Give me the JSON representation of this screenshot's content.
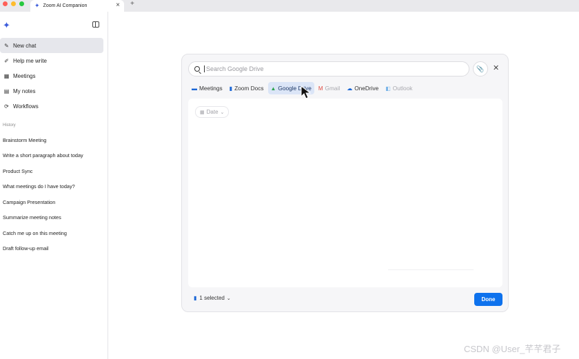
{
  "tab": {
    "title": "Zoom AI Companion",
    "close_glyph": "×",
    "new_tab_glyph": "+"
  },
  "sidebar": {
    "nav": [
      {
        "label": "New chat",
        "icon": "edit-icon",
        "glyph": "✎"
      },
      {
        "label": "Help me write",
        "icon": "magic-pen-icon",
        "glyph": "✐"
      },
      {
        "label": "Meetings",
        "icon": "calendar-icon",
        "glyph": "▦"
      },
      {
        "label": "My notes",
        "icon": "notes-icon",
        "glyph": "▤"
      },
      {
        "label": "Workflows",
        "icon": "workflow-icon",
        "glyph": "⟳"
      }
    ],
    "history_label": "History",
    "history": [
      "Brainstorm Meeting",
      "Write a short paragraph about today",
      "Product Sync",
      "What meetings do I have today?",
      "Campaign Presentation",
      "Summarize meeting notes",
      "Catch me up on this meeting",
      "Draft follow-up email"
    ]
  },
  "dialog": {
    "search": {
      "placeholder": "Search Google Drive",
      "value": ""
    },
    "sources": [
      {
        "label": "Meetings",
        "glyph": "▬",
        "icon": "meetings-icon",
        "state": "normal"
      },
      {
        "label": "Zoom Docs",
        "glyph": "▮",
        "icon": "zoom-docs-icon",
        "state": "normal"
      },
      {
        "label": "Google Drive",
        "glyph": "▲",
        "icon": "google-drive-icon",
        "state": "active"
      },
      {
        "label": "Gmail",
        "glyph": "M",
        "icon": "gmail-icon",
        "state": "disabled"
      },
      {
        "label": "OneDrive",
        "glyph": "☁",
        "icon": "onedrive-icon",
        "state": "normal"
      },
      {
        "label": "Outlook",
        "glyph": "◧",
        "icon": "outlook-icon",
        "state": "disabled"
      }
    ],
    "date_filter": "Date",
    "selected_label": "1 selected",
    "done_label": "Done"
  },
  "watermark": "CSDN @User_芊芊君子",
  "colors": {
    "accent": "#0e72ed",
    "active_source_bg": "#dbe5f7",
    "brand_spark": "#3b5bdb"
  }
}
